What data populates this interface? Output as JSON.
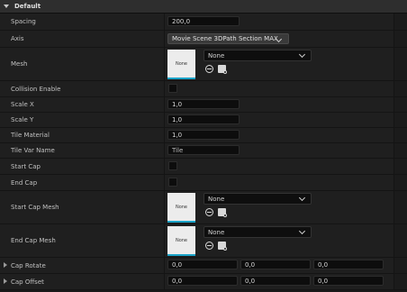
{
  "section": {
    "title": "Default"
  },
  "spacing": {
    "label": "Spacing",
    "value": "200,0"
  },
  "axis": {
    "label": "Axis",
    "value": "Movie Scene 3DPath Section MAX"
  },
  "mesh": {
    "label": "Mesh",
    "thumb": "None",
    "value": "None"
  },
  "collision": {
    "label": "Collision Enable"
  },
  "scale_x": {
    "label": "Scale X",
    "value": "1,0"
  },
  "scale_y": {
    "label": "Scale Y",
    "value": "1,0"
  },
  "tile_material": {
    "label": "Tile Material",
    "value": "1,0"
  },
  "tile_var_name": {
    "label": "Tile Var Name",
    "value": "Tile"
  },
  "start_cap": {
    "label": "Start Cap"
  },
  "end_cap": {
    "label": "End Cap"
  },
  "start_cap_mesh": {
    "label": "Start Cap Mesh",
    "thumb": "None",
    "value": "None"
  },
  "end_cap_mesh": {
    "label": "End Cap Mesh",
    "thumb": "None",
    "value": "None"
  },
  "cap_rotate": {
    "label": "Cap Rotate",
    "values": [
      "0,0",
      "0,0",
      "0,0"
    ]
  },
  "cap_offset": {
    "label": "Cap Offset",
    "values": [
      "0,0",
      "0,0",
      "0,0"
    ]
  },
  "icons": {
    "reset": "reset-to-default-icon",
    "browse": "browse-asset-icon",
    "dropdown": "chevron-down-icon",
    "expand": "expand-arrow-icon"
  },
  "colors": {
    "panel_bg": "#1f1f1f",
    "header_bg": "#2e2e2e",
    "field_bg": "#0d0d0d",
    "thumb_accent": "#1aa3c8"
  }
}
